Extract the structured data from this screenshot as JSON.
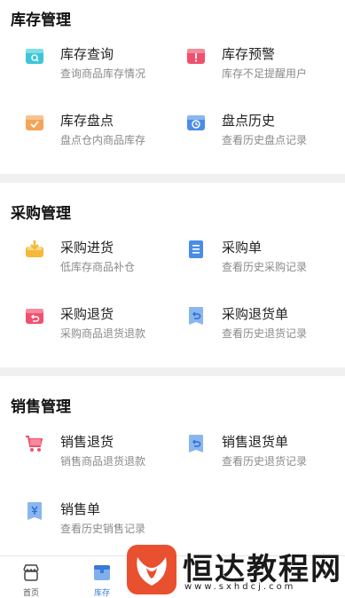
{
  "sections": [
    {
      "title": "库存管理",
      "items": [
        {
          "name": "库存查询",
          "desc": "查询商品库存情况",
          "icon": "inventory-search-icon"
        },
        {
          "name": "库存预警",
          "desc": "库存不足提醒用户",
          "icon": "inventory-alert-icon"
        },
        {
          "name": "库存盘点",
          "desc": "盘点仓内商品库存",
          "icon": "inventory-check-icon"
        },
        {
          "name": "盘点历史",
          "desc": "查看历史盘点记录",
          "icon": "clock-icon"
        }
      ]
    },
    {
      "title": "采购管理",
      "items": [
        {
          "name": "采购进货",
          "desc": "低库存商品补仓",
          "icon": "inbox-download-icon"
        },
        {
          "name": "采购单",
          "desc": "查看历史采购记录",
          "icon": "document-list-icon"
        },
        {
          "name": "采购退货",
          "desc": "采购商品退货退款",
          "icon": "return-box-icon"
        },
        {
          "name": "采购退货单",
          "desc": "查看历史退货记录",
          "icon": "return-document-icon"
        }
      ]
    },
    {
      "title": "销售管理",
      "items": [
        {
          "name": "销售退货",
          "desc": "销售商品退货退款",
          "icon": "cart-icon"
        },
        {
          "name": "销售退货单",
          "desc": "查看历史退货记录",
          "icon": "return-document-icon"
        },
        {
          "name": "销售单",
          "desc": "查看历史销售记录",
          "icon": "currency-document-icon"
        }
      ]
    }
  ],
  "tabbar": {
    "home": "首页",
    "inventory": "库存"
  },
  "watermark": {
    "text": "恒达教程网",
    "url": "www.sxhdcj.com"
  },
  "colors": {
    "cyan": "#3ec6d6",
    "red": "#f0506e",
    "orange": "#f5a35a",
    "blue": "#4a8de8",
    "yellow": "#f5b83a",
    "accent": "#3a7bd5",
    "divider": "#f0f0f0"
  }
}
